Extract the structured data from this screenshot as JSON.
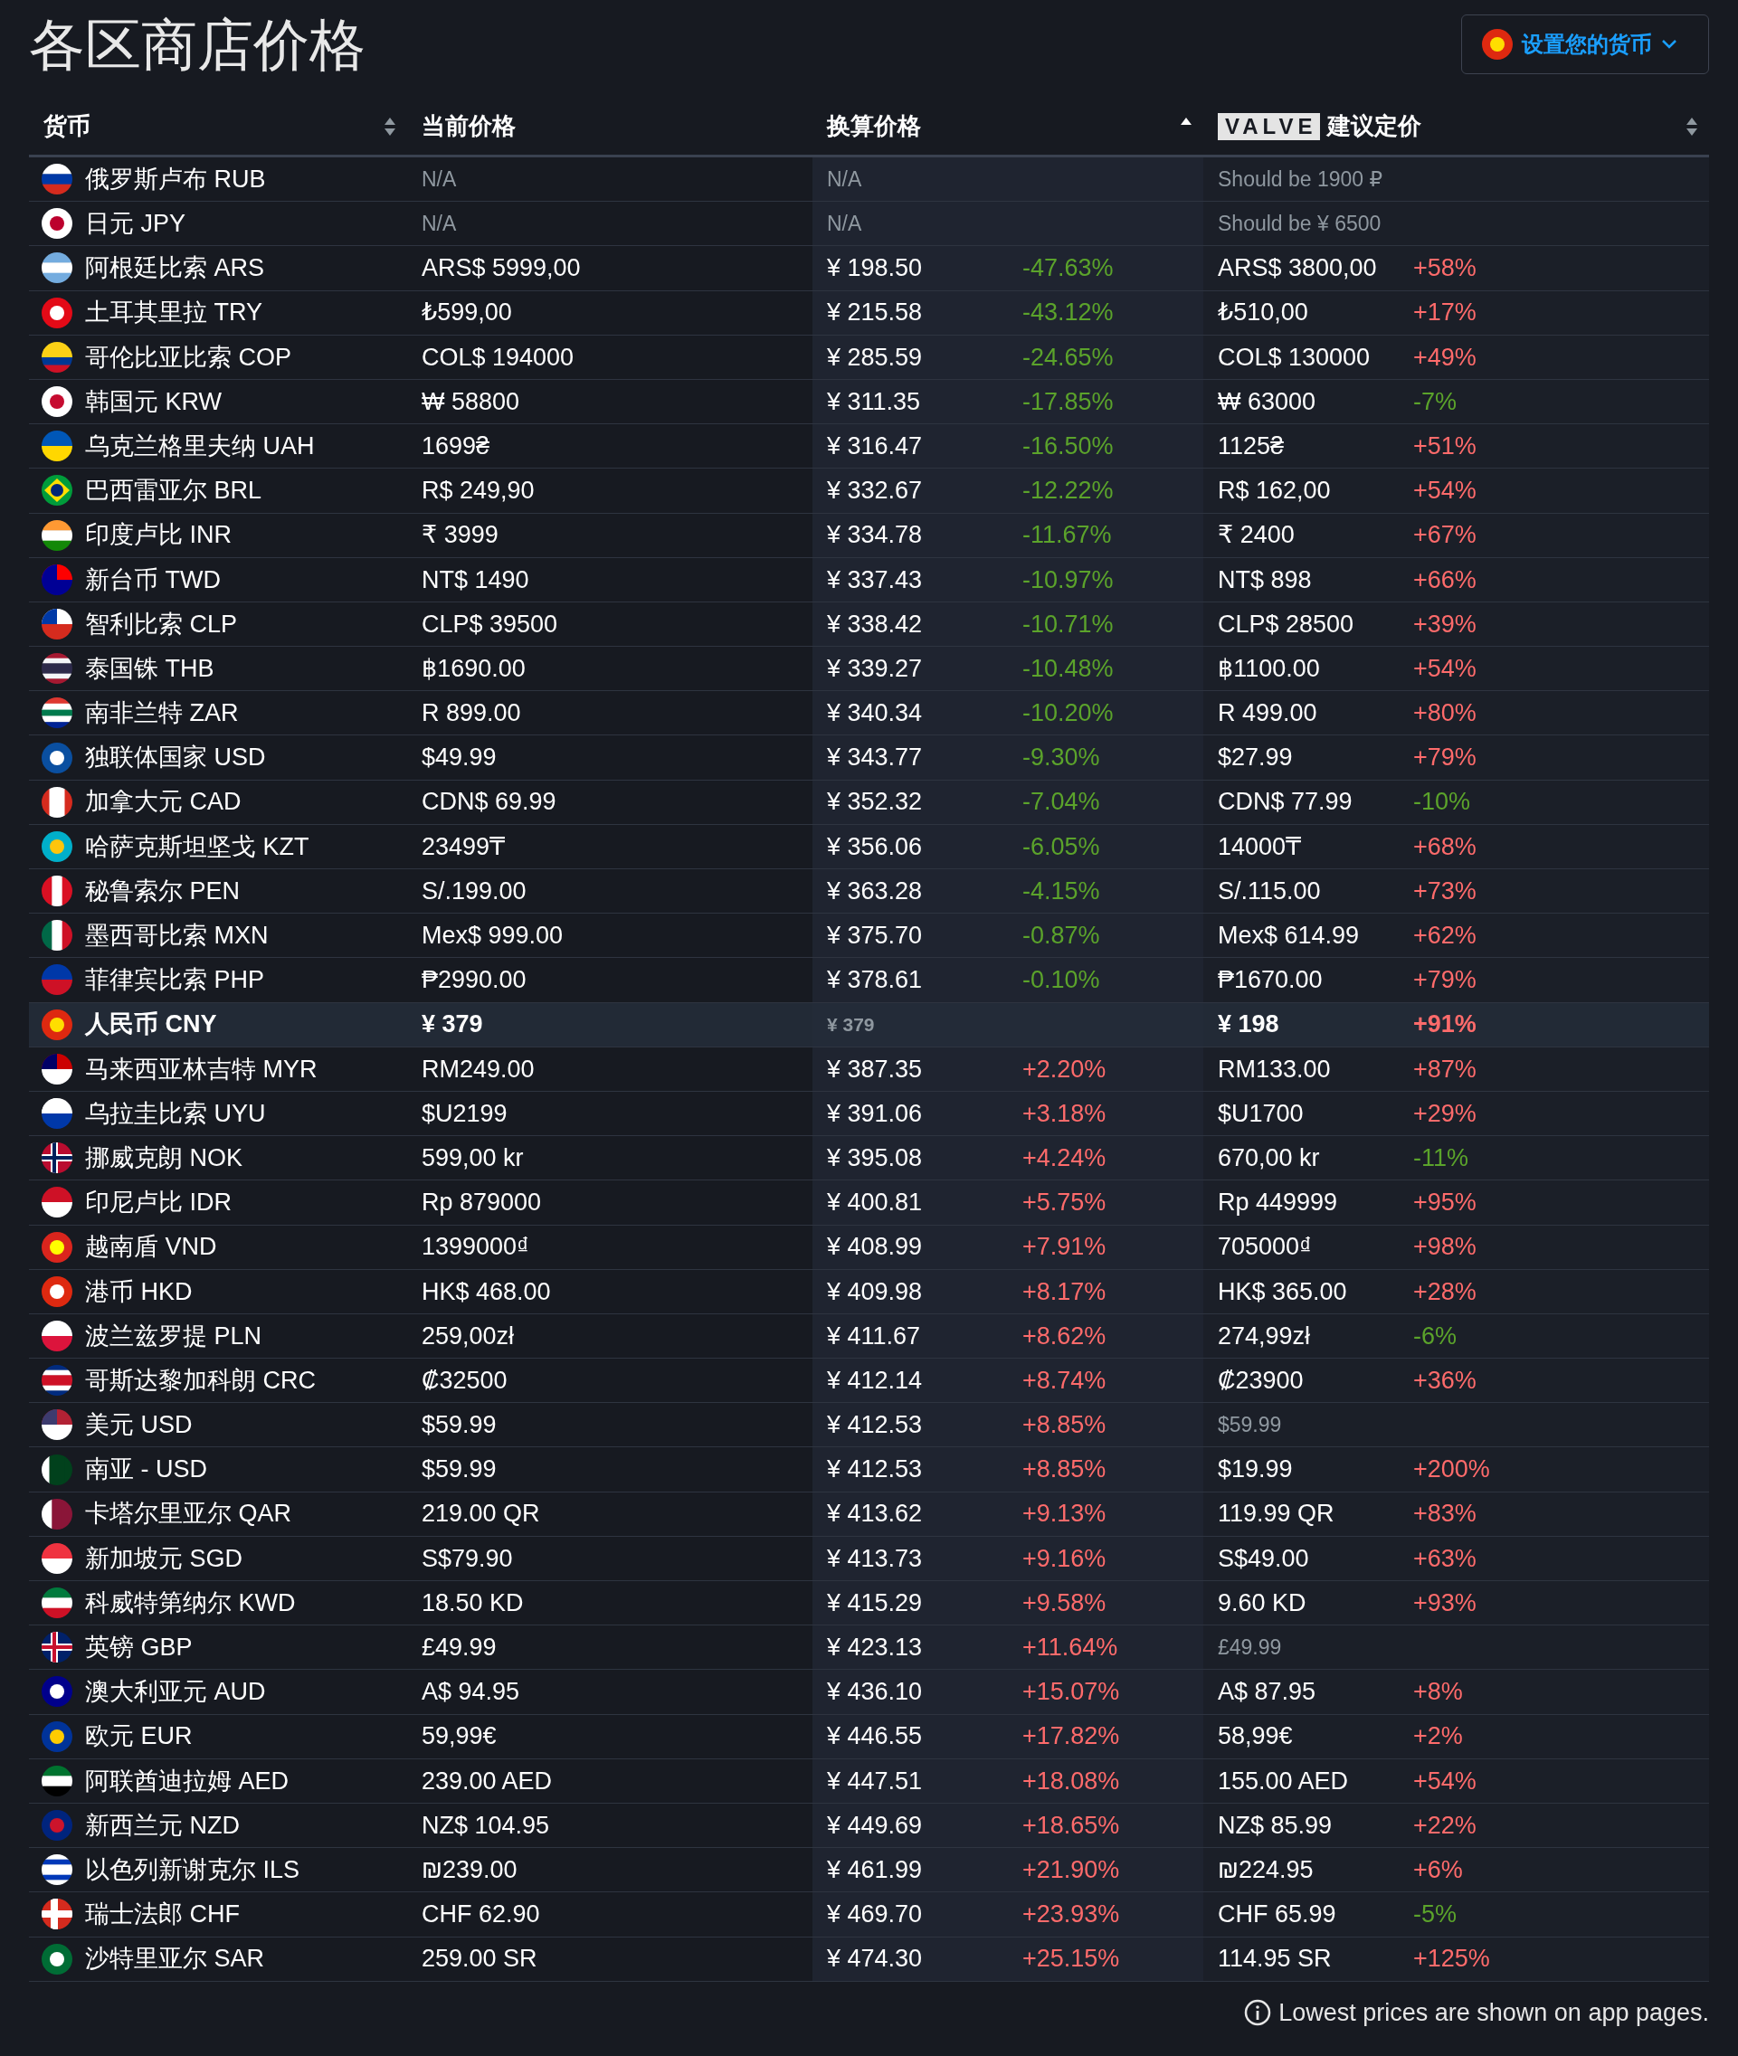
{
  "title": "各区商店价格",
  "currency_button": {
    "label": "设置您的货币"
  },
  "columns": [
    {
      "kind": "sortable",
      "label": "货币"
    },
    {
      "kind": "plain",
      "label": "当前价格"
    },
    {
      "kind": "sorted_ascending",
      "label": "换算价格"
    },
    {
      "kind": "sortable",
      "logo": "VALVE",
      "label": "建议定价"
    }
  ],
  "rows": [
    {
      "kind": "unavailable",
      "currency": "俄罗斯卢布 RUB",
      "price": "N/A",
      "converted": "N/A",
      "suggested": "Should be 1900 ₽",
      "suggested_muted": true
    },
    {
      "kind": "unavailable",
      "currency": "日元 JPY",
      "price": "N/A",
      "converted": "N/A",
      "suggested": "Should be ¥ 6500",
      "suggested_muted": true
    },
    {
      "kind": "regular",
      "currency": "阿根廷比索 ARS",
      "price": "ARS$ 5999,00",
      "converted": "¥ 198.50",
      "converted_change": "-47.63%",
      "converted_increase": false,
      "suggested": "ARS$ 3800,00",
      "suggested_change": "+58%",
      "suggested_increase": true,
      "suggested_muted": false
    },
    {
      "kind": "regular",
      "currency": "土耳其里拉 TRY",
      "price": "₺599,00",
      "converted": "¥ 215.58",
      "converted_change": "-43.12%",
      "converted_increase": false,
      "suggested": "₺510,00",
      "suggested_change": "+17%",
      "suggested_increase": true,
      "suggested_muted": false
    },
    {
      "kind": "regular",
      "currency": "哥伦比亚比索 COP",
      "price": "COL$ 194000",
      "converted": "¥ 285.59",
      "converted_change": "-24.65%",
      "converted_increase": false,
      "suggested": "COL$ 130000",
      "suggested_change": "+49%",
      "suggested_increase": true,
      "suggested_muted": false
    },
    {
      "kind": "regular",
      "currency": "韩国元 KRW",
      "price": "₩ 58800",
      "converted": "¥ 311.35",
      "converted_change": "-17.85%",
      "converted_increase": false,
      "suggested": "₩ 63000",
      "suggested_change": "-7%",
      "suggested_increase": false,
      "suggested_muted": false
    },
    {
      "kind": "regular",
      "currency": "乌克兰格里夫纳 UAH",
      "price": "1699₴",
      "converted": "¥ 316.47",
      "converted_change": "-16.50%",
      "converted_increase": false,
      "suggested": "1125₴",
      "suggested_change": "+51%",
      "suggested_increase": true,
      "suggested_muted": false
    },
    {
      "kind": "regular",
      "currency": "巴西雷亚尔 BRL",
      "price": "R$ 249,90",
      "converted": "¥ 332.67",
      "converted_change": "-12.22%",
      "converted_increase": false,
      "suggested": "R$ 162,00",
      "suggested_change": "+54%",
      "suggested_increase": true,
      "suggested_muted": false
    },
    {
      "kind": "regular",
      "currency": "印度卢比 INR",
      "price": "₹ 3999",
      "converted": "¥ 334.78",
      "converted_change": "-11.67%",
      "converted_increase": false,
      "suggested": "₹ 2400",
      "suggested_change": "+67%",
      "suggested_increase": true,
      "suggested_muted": false
    },
    {
      "kind": "regular",
      "currency": "新台币 TWD",
      "price": "NT$ 1490",
      "converted": "¥ 337.43",
      "converted_change": "-10.97%",
      "converted_increase": false,
      "suggested": "NT$ 898",
      "suggested_change": "+66%",
      "suggested_increase": true,
      "suggested_muted": false
    },
    {
      "kind": "regular",
      "currency": "智利比索 CLP",
      "price": "CLP$ 39500",
      "converted": "¥ 338.42",
      "converted_change": "-10.71%",
      "converted_increase": false,
      "suggested": "CLP$ 28500",
      "suggested_change": "+39%",
      "suggested_increase": true,
      "suggested_muted": false
    },
    {
      "kind": "regular",
      "currency": "泰国铢 THB",
      "price": "฿1690.00",
      "converted": "¥ 339.27",
      "converted_change": "-10.48%",
      "converted_increase": false,
      "suggested": "฿1100.00",
      "suggested_change": "+54%",
      "suggested_increase": true,
      "suggested_muted": false
    },
    {
      "kind": "regular",
      "currency": "南非兰特 ZAR",
      "price": "R 899.00",
      "converted": "¥ 340.34",
      "converted_change": "-10.20%",
      "converted_increase": false,
      "suggested": "R 499.00",
      "suggested_change": "+80%",
      "suggested_increase": true,
      "suggested_muted": false
    },
    {
      "kind": "regular",
      "currency": "独联体国家 USD",
      "price": "$49.99",
      "converted": "¥ 343.77",
      "converted_change": "-9.30%",
      "converted_increase": false,
      "suggested": "$27.99",
      "suggested_change": "+79%",
      "suggested_increase": true,
      "suggested_muted": false
    },
    {
      "kind": "regular",
      "currency": "加拿大元 CAD",
      "price": "CDN$ 69.99",
      "converted": "¥ 352.32",
      "converted_change": "-7.04%",
      "converted_increase": false,
      "suggested": "CDN$ 77.99",
      "suggested_change": "-10%",
      "suggested_increase": false,
      "suggested_muted": false
    },
    {
      "kind": "regular",
      "currency": "哈萨克斯坦坚戈 KZT",
      "price": "23499₸",
      "converted": "¥ 356.06",
      "converted_change": "-6.05%",
      "converted_increase": false,
      "suggested": "14000₸",
      "suggested_change": "+68%",
      "suggested_increase": true,
      "suggested_muted": false
    },
    {
      "kind": "regular",
      "currency": "秘鲁索尔 PEN",
      "price": "S/.199.00",
      "converted": "¥ 363.28",
      "converted_change": "-4.15%",
      "converted_increase": false,
      "suggested": "S/.115.00",
      "suggested_change": "+73%",
      "suggested_increase": true,
      "suggested_muted": false
    },
    {
      "kind": "regular",
      "currency": "墨西哥比索 MXN",
      "price": "Mex$ 999.00",
      "converted": "¥ 375.70",
      "converted_change": "-0.87%",
      "converted_increase": false,
      "suggested": "Mex$ 614.99",
      "suggested_change": "+62%",
      "suggested_increase": true,
      "suggested_muted": false
    },
    {
      "kind": "regular",
      "currency": "菲律宾比索 PHP",
      "price": "₱2990.00",
      "converted": "¥ 378.61",
      "converted_change": "-0.10%",
      "converted_increase": false,
      "suggested": "₱1670.00",
      "suggested_change": "+79%",
      "suggested_increase": true,
      "suggested_muted": false
    },
    {
      "kind": "home",
      "currency": "人民币 CNY",
      "price": "¥ 379",
      "converted": "¥ 379",
      "suggested": "¥ 198",
      "suggested_change": "+91%",
      "suggested_increase": true,
      "suggested_muted": false
    },
    {
      "kind": "regular",
      "currency": "马来西亚林吉特 MYR",
      "price": "RM249.00",
      "converted": "¥ 387.35",
      "converted_change": "+2.20%",
      "converted_increase": true,
      "suggested": "RM133.00",
      "suggested_change": "+87%",
      "suggested_increase": true,
      "suggested_muted": false
    },
    {
      "kind": "regular",
      "currency": "乌拉圭比索 UYU",
      "price": "$U2199",
      "converted": "¥ 391.06",
      "converted_change": "+3.18%",
      "converted_increase": true,
      "suggested": "$U1700",
      "suggested_change": "+29%",
      "suggested_increase": true,
      "suggested_muted": false
    },
    {
      "kind": "regular",
      "currency": "挪威克朗 NOK",
      "price": "599,00 kr",
      "converted": "¥ 395.08",
      "converted_change": "+4.24%",
      "converted_increase": true,
      "suggested": "670,00 kr",
      "suggested_change": "-11%",
      "suggested_increase": false,
      "suggested_muted": false
    },
    {
      "kind": "regular",
      "currency": "印尼卢比 IDR",
      "price": "Rp 879000",
      "converted": "¥ 400.81",
      "converted_change": "+5.75%",
      "converted_increase": true,
      "suggested": "Rp 449999",
      "suggested_change": "+95%",
      "suggested_increase": true,
      "suggested_muted": false
    },
    {
      "kind": "regular",
      "currency": "越南盾 VND",
      "price": "1399000₫",
      "converted": "¥ 408.99",
      "converted_change": "+7.91%",
      "converted_increase": true,
      "suggested": "705000₫",
      "suggested_change": "+98%",
      "suggested_increase": true,
      "suggested_muted": false
    },
    {
      "kind": "regular",
      "currency": "港币 HKD",
      "price": "HK$ 468.00",
      "converted": "¥ 409.98",
      "converted_change": "+8.17%",
      "converted_increase": true,
      "suggested": "HK$ 365.00",
      "suggested_change": "+28%",
      "suggested_increase": true,
      "suggested_muted": false
    },
    {
      "kind": "regular",
      "currency": "波兰兹罗提 PLN",
      "price": "259,00zł",
      "converted": "¥ 411.67",
      "converted_change": "+8.62%",
      "converted_increase": true,
      "suggested": "274,99zł",
      "suggested_change": "-6%",
      "suggested_increase": false,
      "suggested_muted": false
    },
    {
      "kind": "regular",
      "currency": "哥斯达黎加科朗 CRC",
      "price": "₡32500",
      "converted": "¥ 412.14",
      "converted_change": "+8.74%",
      "converted_increase": true,
      "suggested": "₡23900",
      "suggested_change": "+36%",
      "suggested_increase": true,
      "suggested_muted": false
    },
    {
      "kind": "regular",
      "currency": "美元 USD",
      "price": "$59.99",
      "converted": "¥ 412.53",
      "converted_change": "+8.85%",
      "converted_increase": true,
      "suggested": "$59.99",
      "suggested_muted": true
    },
    {
      "kind": "regular",
      "currency": "南亚 - USD",
      "price": "$59.99",
      "converted": "¥ 412.53",
      "converted_change": "+8.85%",
      "converted_increase": true,
      "suggested": "$19.99",
      "suggested_change": "+200%",
      "suggested_increase": true,
      "suggested_muted": false
    },
    {
      "kind": "regular",
      "currency": "卡塔尔里亚尔 QAR",
      "price": "219.00 QR",
      "converted": "¥ 413.62",
      "converted_change": "+9.13%",
      "converted_increase": true,
      "suggested": "119.99 QR",
      "suggested_change": "+83%",
      "suggested_increase": true,
      "suggested_muted": false
    },
    {
      "kind": "regular",
      "currency": "新加坡元 SGD",
      "price": "S$79.90",
      "converted": "¥ 413.73",
      "converted_change": "+9.16%",
      "converted_increase": true,
      "suggested": "S$49.00",
      "suggested_change": "+63%",
      "suggested_increase": true,
      "suggested_muted": false
    },
    {
      "kind": "regular",
      "currency": "科威特第纳尔 KWD",
      "price": "18.50 KD",
      "converted": "¥ 415.29",
      "converted_change": "+9.58%",
      "converted_increase": true,
      "suggested": "9.60 KD",
      "suggested_change": "+93%",
      "suggested_increase": true,
      "suggested_muted": false
    },
    {
      "kind": "regular",
      "currency": "英镑 GBP",
      "price": "£49.99",
      "converted": "¥ 423.13",
      "converted_change": "+11.64%",
      "converted_increase": true,
      "suggested": "£49.99",
      "suggested_muted": true
    },
    {
      "kind": "regular",
      "currency": "澳大利亚元 AUD",
      "price": "A$ 94.95",
      "converted": "¥ 436.10",
      "converted_change": "+15.07%",
      "converted_increase": true,
      "suggested": "A$ 87.95",
      "suggested_change": "+8%",
      "suggested_increase": true,
      "suggested_muted": false
    },
    {
      "kind": "regular",
      "currency": "欧元 EUR",
      "price": "59,99€",
      "converted": "¥ 446.55",
      "converted_change": "+17.82%",
      "converted_increase": true,
      "suggested": "58,99€",
      "suggested_change": "+2%",
      "suggested_increase": true,
      "suggested_muted": false
    },
    {
      "kind": "regular",
      "currency": "阿联酋迪拉姆 AED",
      "price": "239.00 AED",
      "converted": "¥ 447.51",
      "converted_change": "+18.08%",
      "converted_increase": true,
      "suggested": "155.00 AED",
      "suggested_change": "+54%",
      "suggested_increase": true,
      "suggested_muted": false
    },
    {
      "kind": "regular",
      "currency": "新西兰元 NZD",
      "price": "NZ$ 104.95",
      "converted": "¥ 449.69",
      "converted_change": "+18.65%",
      "converted_increase": true,
      "suggested": "NZ$ 85.99",
      "suggested_change": "+22%",
      "suggested_increase": true,
      "suggested_muted": false
    },
    {
      "kind": "regular",
      "currency": "以色列新谢克尔 ILS",
      "price": "₪239.00",
      "converted": "¥ 461.99",
      "converted_change": "+21.90%",
      "converted_increase": true,
      "suggested": "₪224.95",
      "suggested_change": "+6%",
      "suggested_increase": true,
      "suggested_muted": false
    },
    {
      "kind": "regular",
      "currency": "瑞士法郎 CHF",
      "price": "CHF 62.90",
      "converted": "¥ 469.70",
      "converted_change": "+23.93%",
      "converted_increase": true,
      "suggested": "CHF 65.99",
      "suggested_change": "-5%",
      "suggested_increase": false,
      "suggested_muted": false
    },
    {
      "kind": "regular",
      "currency": "沙特里亚尔 SAR",
      "price": "259.00 SR",
      "converted": "¥ 474.30",
      "converted_change": "+25.15%",
      "converted_increase": true,
      "suggested": "114.95 SR",
      "suggested_change": "+125%",
      "suggested_increase": true,
      "suggested_muted": false
    }
  ],
  "footnote": "Lowest prices are shown on app pages."
}
